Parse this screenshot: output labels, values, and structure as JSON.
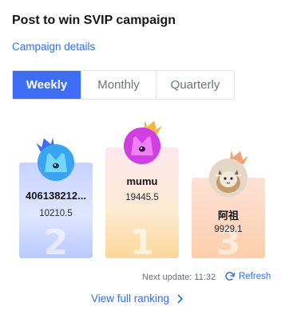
{
  "header": {
    "title": "Post to win SVIP campaign",
    "details_link": "Campaign details"
  },
  "tabs": [
    {
      "label": "Weekly",
      "active": true
    },
    {
      "label": "Monthly",
      "active": false
    },
    {
      "label": "Quarterly",
      "active": false
    }
  ],
  "ranking": [
    {
      "rank": "2",
      "name": "406138212...",
      "score": "10210.5",
      "avatar_icon": "m-logo-blue"
    },
    {
      "rank": "1",
      "name": "mumu",
      "score": "19445.5",
      "avatar_icon": "m-logo-purple"
    },
    {
      "rank": "3",
      "name": "阿祖",
      "score": "9929.1",
      "avatar_icon": "cat-photo"
    }
  ],
  "footer": {
    "next_update": "Next update: 11:32",
    "refresh_label": "Refresh",
    "view_full": "View full ranking"
  },
  "colors": {
    "accent": "#3d6ef5",
    "link": "#2f6fe8"
  }
}
